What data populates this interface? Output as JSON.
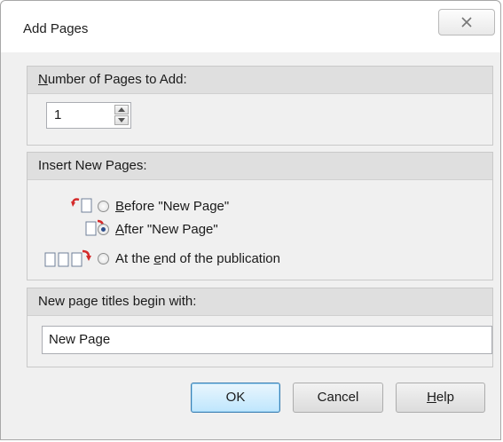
{
  "dialog": {
    "title": "Add Pages",
    "close_symbol": "☒"
  },
  "count_section": {
    "header_underlined": "N",
    "header_rest": "umber of Pages to Add:",
    "value": "1",
    "spin_up_icon": "spin-up-arrow",
    "spin_down_icon": "spin-down-arrow"
  },
  "insert_section": {
    "header": "Insert New Pages:",
    "options": [
      {
        "icon": "insert-before-icon",
        "underlined": "B",
        "rest": "efore \"New Page\"",
        "checked": false
      },
      {
        "icon": "insert-after-icon",
        "underlined": "A",
        "rest": "fter \"New Page\"",
        "checked": true
      },
      {
        "icon": "insert-end-icon",
        "pre": "At the ",
        "underlined": "e",
        "rest": "nd of the publication",
        "checked": false
      }
    ]
  },
  "titles_section": {
    "header": "New page titles begin with:",
    "value": "New Page"
  },
  "buttons": {
    "ok": "OK",
    "cancel": "Cancel",
    "help_underlined": "H",
    "help_rest": "elp"
  },
  "colors": {
    "arrow_red": "#d42a2a",
    "header_bg": "#dfdfdf",
    "dialog_bg": "#f0f0f0"
  }
}
